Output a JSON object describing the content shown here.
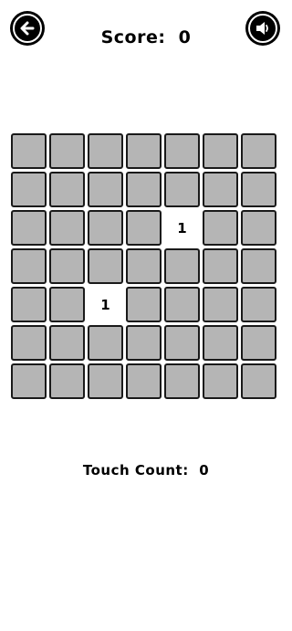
{
  "header": {
    "score_label": "Score:",
    "score_value": "0"
  },
  "icons": {
    "back": "arrow-left-icon",
    "sound": "speaker-icon"
  },
  "board": {
    "rows": 7,
    "cols": 7,
    "cells": [
      [
        "",
        "",
        "",
        "",
        "",
        "",
        ""
      ],
      [
        "",
        "",
        "",
        "",
        "",
        "",
        ""
      ],
      [
        "",
        "",
        "",
        "",
        "1",
        "",
        ""
      ],
      [
        "",
        "",
        "",
        "",
        "",
        "",
        ""
      ],
      [
        "",
        "",
        "1",
        "",
        "",
        "",
        ""
      ],
      [
        "",
        "",
        "",
        "",
        "",
        "",
        ""
      ],
      [
        "",
        "",
        "",
        "",
        "",
        "",
        ""
      ]
    ]
  },
  "footer": {
    "touch_label": "Touch Count:",
    "touch_value": "0"
  },
  "colors": {
    "tile_hidden": "#b5b5b5",
    "tile_revealed": "#ffffff",
    "tile_border": "#1a1a1a"
  }
}
